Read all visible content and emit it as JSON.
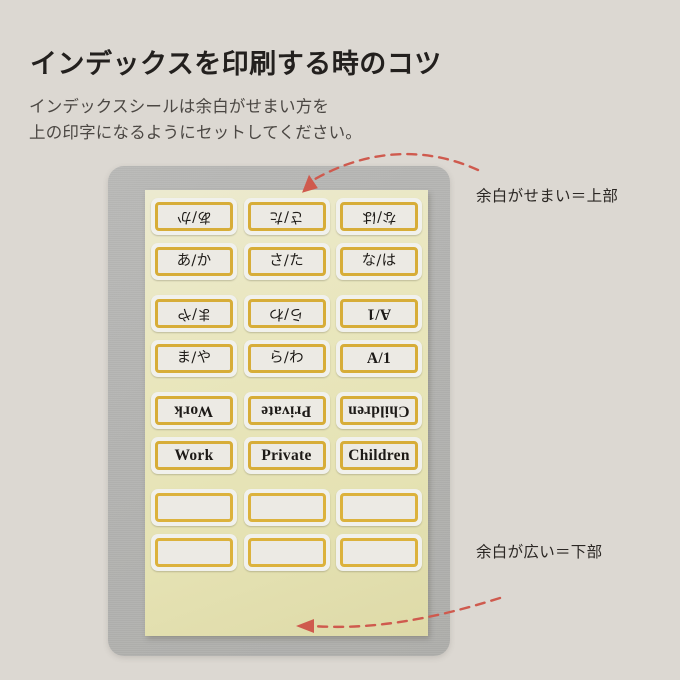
{
  "page": {
    "title": "インデックスを印刷する時のコツ",
    "subtitle": "インデックスシールは余白がせまい方を\n上の印字になるようにセットしてください。",
    "background_color": "#dcd8d2",
    "title_color": "#23201e",
    "subtitle_color": "#4b4743"
  },
  "annotations": {
    "top": {
      "text": "余白がせまい＝上部",
      "arrow": "dashed-curved-arrow-pointing-left-down",
      "color": "#cf5a4e"
    },
    "bottom": {
      "text": "余白が広い＝下部",
      "arrow": "dashed-curved-arrow-pointing-left",
      "color": "#cf5a4e"
    }
  },
  "photo": {
    "backing_card_color": "#b4b4b2",
    "sheet_color": "#e8e4b4",
    "sticker_color": "#f1f1ec",
    "frame_border_color": "#d7ad38",
    "sheet": {
      "columns": 3,
      "groups": [
        {
          "labels": [
            {
              "flipped_text": "あ/か",
              "text": "あ/か",
              "script": "jp"
            },
            {
              "flipped_text": "さ/た",
              "text": "さ/た",
              "script": "jp"
            },
            {
              "flipped_text": "な/は",
              "text": "な/は",
              "script": "jp"
            }
          ]
        },
        {
          "labels": [
            {
              "flipped_text": "ま/や",
              "text": "ま/や",
              "script": "jp"
            },
            {
              "flipped_text": "ら/わ",
              "text": "ら/わ",
              "script": "jp"
            },
            {
              "flipped_text": "A/1",
              "text": "A/1",
              "script": "en"
            }
          ]
        },
        {
          "labels": [
            {
              "flipped_text": "Work",
              "text": "Work",
              "script": "en"
            },
            {
              "flipped_text": "Private",
              "text": "Private",
              "script": "en"
            },
            {
              "flipped_text": "Children",
              "text": "Children",
              "script": "en"
            }
          ]
        },
        {
          "labels": [
            {
              "flipped_text": "",
              "text": "",
              "script": "blank"
            },
            {
              "flipped_text": "",
              "text": "",
              "script": "blank"
            },
            {
              "flipped_text": "",
              "text": "",
              "script": "blank"
            }
          ]
        }
      ]
    }
  }
}
